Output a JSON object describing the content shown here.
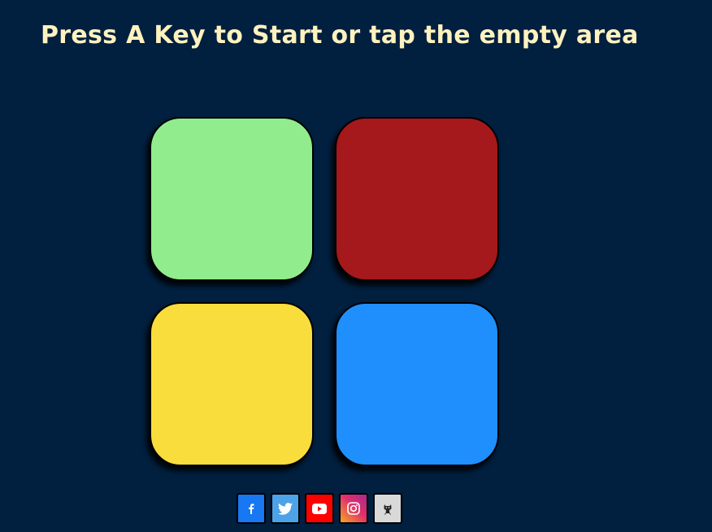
{
  "header": {
    "title": "Press A Key to Start or tap the empty area"
  },
  "pads": [
    {
      "id": "green",
      "color": "#90ec8c"
    },
    {
      "id": "red",
      "color": "#a5181b"
    },
    {
      "id": "yellow",
      "color": "#f9dd3c"
    },
    {
      "id": "blue",
      "color": "#1f8ffe"
    }
  ],
  "social": [
    {
      "name": "facebook-icon",
      "color": "#1877f2"
    },
    {
      "name": "twitter-icon",
      "color": "#4ea2e8"
    },
    {
      "name": "youtube-icon",
      "color": "#ff0000"
    },
    {
      "name": "instagram-icon",
      "color": "#d6296f"
    },
    {
      "name": "github-icon",
      "color": "#d9d9d9"
    }
  ]
}
